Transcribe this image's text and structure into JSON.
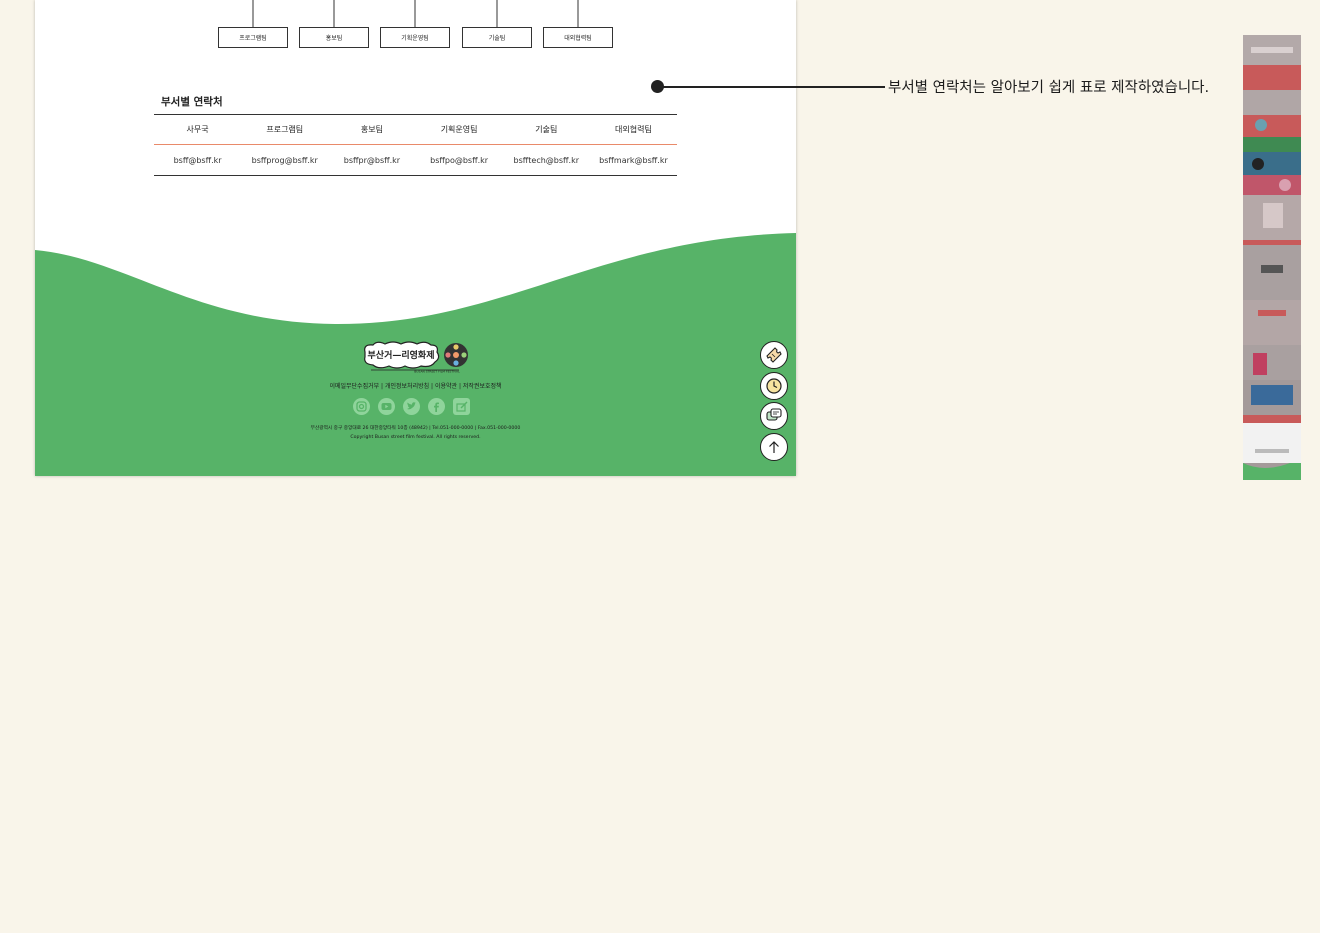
{
  "org_chart": {
    "teams": [
      "프로그램팀",
      "홍보팀",
      "기획운영팀",
      "기술팀",
      "대외협력팀"
    ]
  },
  "contacts": {
    "title": "부서별 연락처",
    "headers": [
      "사무국",
      "프로그램팀",
      "홍보팀",
      "기획운영팀",
      "기술팀",
      "대외협력팀"
    ],
    "emails": [
      "bsff@bsff.kr",
      "bsffprog@bsff.kr",
      "bsffpr@bsff.kr",
      "bsffpo@bsff.kr",
      "bsfftech@bsff.kr",
      "bsffmark@bsff.kr"
    ]
  },
  "footer": {
    "logo_text": "부산거—리영화제",
    "logo_subtext": "BUSAN STREET FILM FESTIVAL",
    "links": "이메일무단수집거부 | 개인정보처리방침 | 이용약관 | 저작권보호정책",
    "socials": [
      "instagram-icon",
      "youtube-icon",
      "twitter-icon",
      "facebook-icon",
      "blog-icon"
    ],
    "address": "부산광역시 중구 중앙대로 26 대한중앙타워 10층 (48942) | Tel.051-000-0000 | Fax.051-000-0000",
    "copyright": "Copyright Busan street film festival. All rights reserved.",
    "green": "#57b368"
  },
  "quick_menu": [
    "ticket-icon",
    "clock-icon",
    "chat-icon",
    "arrow-up-icon"
  ],
  "annotation": {
    "text": "부서별 연락처는 알아보기 쉽게 표로 제작하였습니다."
  },
  "colors": {
    "background": "#f9f5ea",
    "accent_line": "#e98a6a"
  }
}
